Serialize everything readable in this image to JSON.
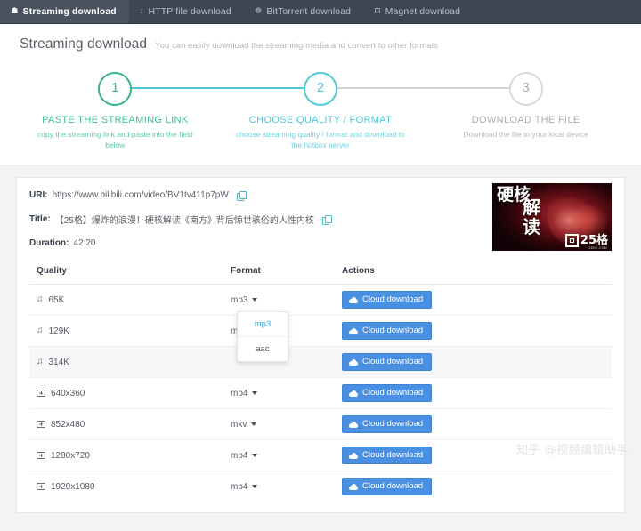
{
  "nav": {
    "tabs": [
      {
        "label": "Streaming download",
        "icon": "video-camera-icon",
        "glyph": "☗",
        "active": true
      },
      {
        "label": "HTTP file download",
        "icon": "file-download-icon",
        "glyph": "↓",
        "active": false
      },
      {
        "label": "BitTorrent download",
        "icon": "bittorrent-icon",
        "glyph": "☸",
        "active": false
      },
      {
        "label": "Magnet download",
        "icon": "magnet-icon",
        "glyph": "⊓",
        "active": false
      }
    ]
  },
  "header": {
    "title": "Streaming download",
    "subtitle": "You can easily download the streaming media and convert to other formats"
  },
  "stepper": {
    "steps": [
      {
        "number": "1",
        "title": "PASTE THE STREAMING LINK",
        "description": "copy the streaming link and paste into the field below",
        "color": "#3bbf9a",
        "state": "done"
      },
      {
        "number": "2",
        "title": "CHOOSE QUALITY / FORMAT",
        "description": "choose streaming quality / format and download to the hotbox server",
        "color": "#4ec8d6",
        "state": "current"
      },
      {
        "number": "3",
        "title": "DOWNLOAD THE FILE",
        "description": "Download the file to your local device",
        "color": "#a9adb4",
        "state": "pending"
      }
    ]
  },
  "media": {
    "uri_label": "URI:",
    "uri_value": "https://www.bilibili.com/video/BV1tv411p7pW",
    "title_label": "Title:",
    "title_value": "【25格】爆炸的浪漫！硬核解读《南方》背后惊世骇俗的人性内核",
    "duration_label": "Duration:",
    "duration_value": "42:20",
    "thumbnail": {
      "text_col1": "硬核",
      "text_col2": "解读",
      "logo_text": "25格",
      "logo_sub": "25GE.COM"
    }
  },
  "table": {
    "columns": [
      "Quality",
      "Format",
      "Actions"
    ],
    "action_label": "Cloud download",
    "rows": [
      {
        "quality": "65K",
        "kind": "audio",
        "format": "mp3",
        "highlight": false
      },
      {
        "quality": "129K",
        "kind": "audio",
        "format": "mp3",
        "highlight": false
      },
      {
        "quality": "314K",
        "kind": "audio",
        "format": "mp3",
        "highlight": true
      },
      {
        "quality": "640x360",
        "kind": "video",
        "format": "mp4",
        "highlight": false
      },
      {
        "quality": "852x480",
        "kind": "video",
        "format": "mkv",
        "highlight": false
      },
      {
        "quality": "1280x720",
        "kind": "video",
        "format": "mp4",
        "highlight": false
      },
      {
        "quality": "1920x1080",
        "kind": "video",
        "format": "mp4",
        "highlight": false
      }
    ]
  },
  "dropdown": {
    "open": true,
    "options": [
      "mp3",
      "aac"
    ],
    "selected": "mp3"
  },
  "watermark": "知乎 @视频编辑助手",
  "colors": {
    "nav_bg": "#3e4656",
    "step_done": "#3bbf9a",
    "step_current": "#4ec8d6",
    "step_pending": "#a9adb4",
    "button": "#4a90e2",
    "dropdown_selected": "#38a8d8",
    "band_bg": "#f3f3f5"
  }
}
